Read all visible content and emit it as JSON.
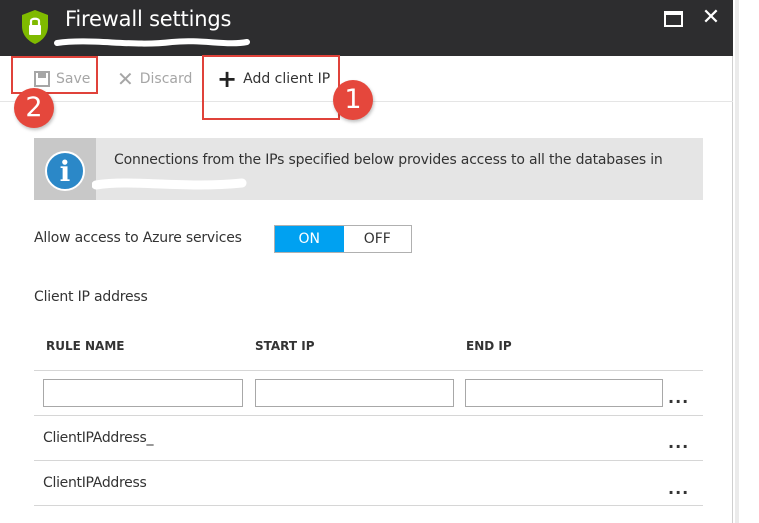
{
  "header": {
    "title": "Firewall settings"
  },
  "window_controls": {
    "maximize_icon": "maximize-icon",
    "close_glyph": "✕"
  },
  "toolbar": {
    "save_label": "Save",
    "discard_label": "Discard",
    "add_client_ip_label": "Add client IP"
  },
  "annotations": {
    "badge_1": "1",
    "badge_2": "2",
    "color": "#e5473c"
  },
  "info_banner": {
    "icon_glyph": "i",
    "text": "Connections from the IPs specified below provides access to all the databases in"
  },
  "azure_access": {
    "label": "Allow access to Azure services",
    "on_label": "ON",
    "off_label": "OFF",
    "selected": "ON",
    "accent": "#00a1f1"
  },
  "client_ip": {
    "section_label": "Client IP address",
    "columns": [
      "RULE NAME",
      "START IP",
      "END IP"
    ],
    "new_rule": {
      "rule_name": "",
      "start_ip": "",
      "end_ip": ""
    },
    "rows": [
      {
        "rule_name": "ClientIPAddress_"
      },
      {
        "rule_name": "ClientIPAddress"
      }
    ],
    "more_glyph": "..."
  },
  "colors": {
    "header_bg": "#2d2d2f",
    "shield_green": "#7fba00"
  }
}
